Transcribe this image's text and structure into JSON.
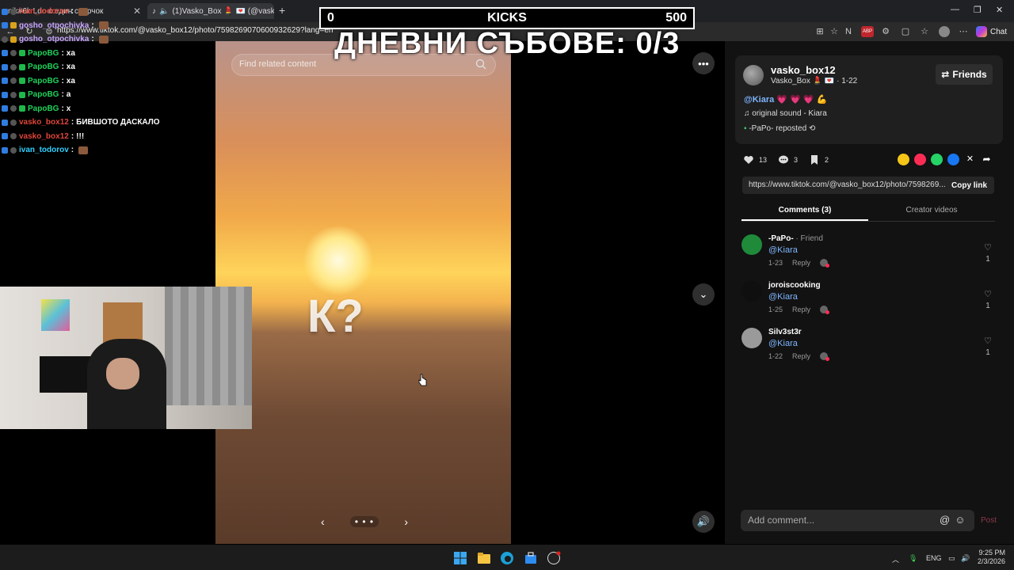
{
  "browser": {
    "tab1_title": "nik#6l: Ldo с един свирчок",
    "tab2_title": "(1)Vasko_Box 💄 💌 (@vasko_",
    "url": "https://www.tiktok.com/@vasko_box12/photo/7598269070600932629?lang=en",
    "chat_label": "Chat",
    "abp_label": "ABP"
  },
  "overlay": {
    "kicks_left": "0",
    "kicks_title": "KICKS",
    "kicks_right": "500",
    "daily_text": "ДНЕВНИ СЪБОВЕ: 0/3"
  },
  "chat": [
    {
      "user": "ivan_todorov",
      "color": "#e0463a",
      "text": "",
      "badges": [
        "kick",
        "sub"
      ],
      "emote": true
    },
    {
      "user": "gosho_otpochivka",
      "color": "#c6a4ff",
      "text": "",
      "badges": [
        "kick",
        "gold"
      ],
      "emote": true
    },
    {
      "user": "gosho_otpochivka",
      "color": "#c6a4ff",
      "text": "",
      "badges": [
        "sub",
        "gold"
      ],
      "emote": true
    },
    {
      "user": "PapoBG",
      "color": "#1fd25a",
      "text": "ха",
      "badges": [
        "kick",
        "sub",
        "green"
      ],
      "emote": false
    },
    {
      "user": "PapoBG",
      "color": "#1fd25a",
      "text": "ха",
      "badges": [
        "kick",
        "sub",
        "green"
      ],
      "emote": false
    },
    {
      "user": "PapoBG",
      "color": "#1fd25a",
      "text": "ха",
      "badges": [
        "kick",
        "sub",
        "green"
      ],
      "emote": false
    },
    {
      "user": "PapoBG",
      "color": "#1fd25a",
      "text": "а",
      "badges": [
        "kick",
        "sub",
        "green"
      ],
      "emote": false
    },
    {
      "user": "PapoBG",
      "color": "#1fd25a",
      "text": "х",
      "badges": [
        "kick",
        "sub",
        "green"
      ],
      "emote": false
    },
    {
      "user": "vasko_box12",
      "color": "#e0463a",
      "text": "БИВШОТО ДАСКАЛО",
      "badges": [
        "kick",
        "sub"
      ],
      "emote": false
    },
    {
      "user": "vasko_box12",
      "color": "#e0463a",
      "text": "!!!",
      "badges": [
        "kick",
        "sub"
      ],
      "emote": false
    },
    {
      "user": "ivan_todorov",
      "color": "#2fd0ff",
      "text": "",
      "badges": [
        "kick",
        "sub"
      ],
      "emote": true
    }
  ],
  "video": {
    "search_placeholder": "Find related content",
    "overlay_text": "К?",
    "dots": "• • •"
  },
  "post": {
    "username": "vasko_box12",
    "display_meta": "Vasko_Box 💄 💌 · 1-22",
    "friends_label": "Friends",
    "mention": "@Kiara",
    "hearts": "💗 💗 💗 💪",
    "sound": "original sound - Kiara",
    "repost": "-PaPo- reposted",
    "likes": "13",
    "comments": "3",
    "saves": "2",
    "link": "https://www.tiktok.com/@vasko_box12/photo/7598269...",
    "copy_link": "Copy link",
    "tab_comments": "Comments (3)",
    "tab_creator": "Creator videos",
    "add_comment_placeholder": "Add comment...",
    "post_label": "Post",
    "colors": {
      "accent": "#ff2d6f",
      "mention": "#7eb6ff",
      "panel": "#121212"
    }
  },
  "comments": [
    {
      "name": "-PaPo-",
      "tag": " · Friend",
      "text": "@Kiara",
      "date": "1-23",
      "reply": "Reply",
      "likes": "1",
      "avatar_color": "#1f8a3a"
    },
    {
      "name": "joroiscooking",
      "tag": "",
      "text": "@Kiara",
      "date": "1-25",
      "reply": "Reply",
      "likes": "1",
      "avatar_color": "#0f0f0f"
    },
    {
      "name": "Silv3st3r",
      "tag": "",
      "text": "@Kiara",
      "date": "1-22",
      "reply": "Reply",
      "likes": "1",
      "avatar_color": "#9a9a9a"
    }
  ],
  "taskbar": {
    "lang": "ENG",
    "time": "9:25 PM",
    "date": "2/3/2026"
  }
}
